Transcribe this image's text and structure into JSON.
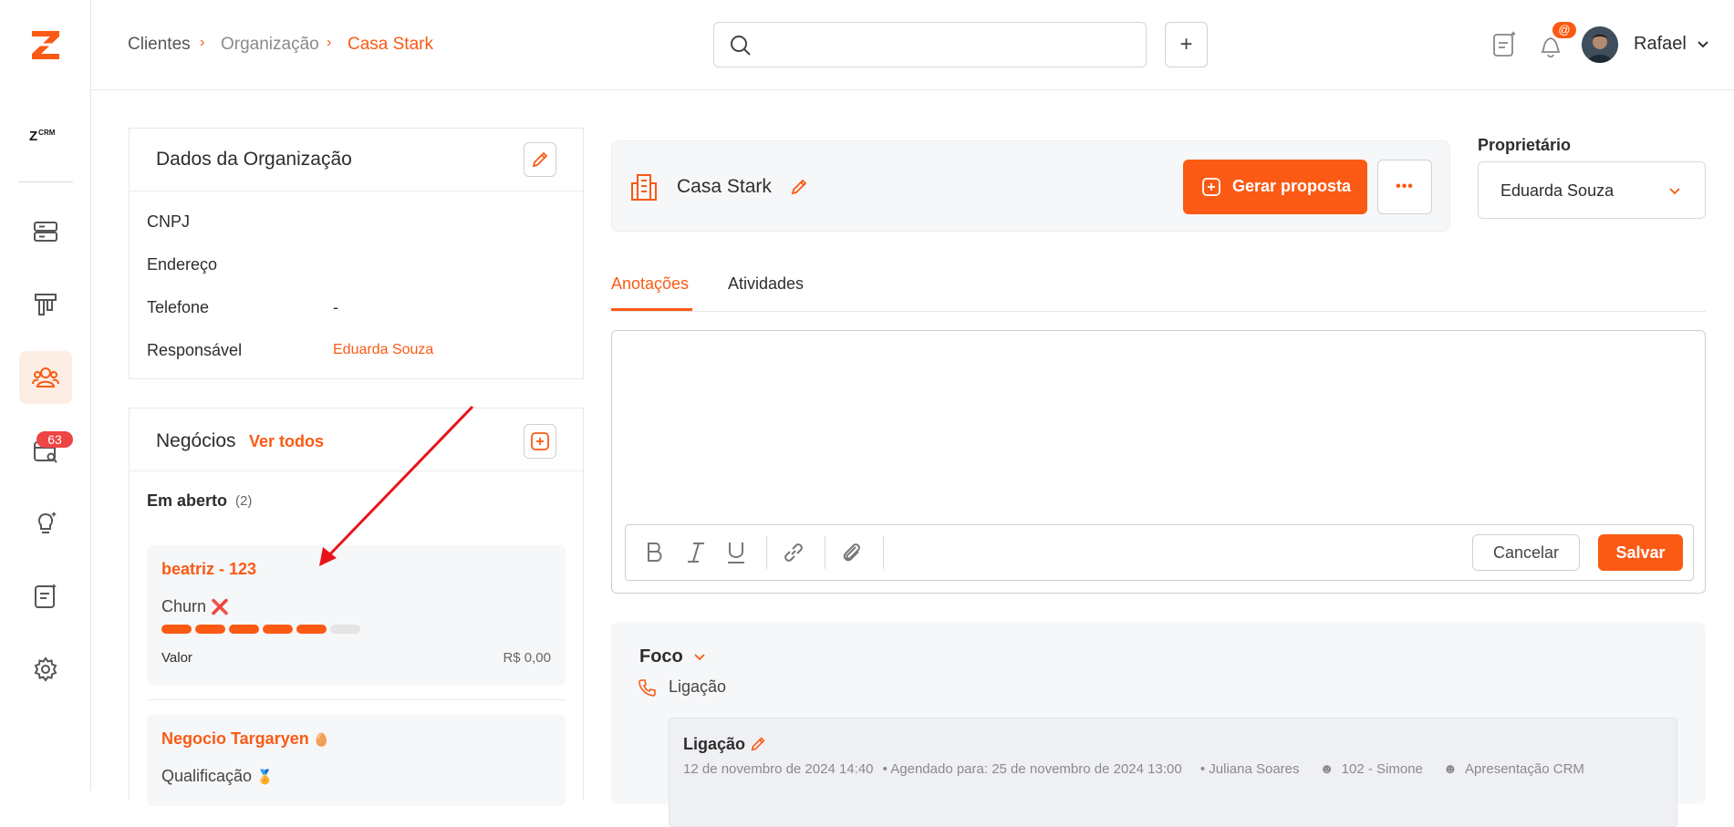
{
  "brand": {
    "logo_letter": "Z",
    "small_logo": "Z",
    "small_logo_suffix": "CRM"
  },
  "sidebar": {
    "items": [
      {
        "icon": "server-icon"
      },
      {
        "icon": "funnel-pillar-icon"
      },
      {
        "icon": "users-icon",
        "active": true
      },
      {
        "icon": "calendar-search-icon",
        "badge": "63"
      },
      {
        "icon": "lightbulb-icon"
      },
      {
        "icon": "note-edit-icon"
      },
      {
        "icon": "gear-icon"
      }
    ]
  },
  "header": {
    "breadcrumb": [
      "Clientes",
      "Organização",
      "Casa Stark"
    ],
    "search_placeholder": "",
    "add_label": "+",
    "notification_badge": "@",
    "user_name": "Rafael"
  },
  "org_panel": {
    "title": "Dados da Organização",
    "fields": [
      {
        "label": "CNPJ",
        "value": ""
      },
      {
        "label": "Endereço",
        "value": ""
      },
      {
        "label": "Telefone",
        "value": "-"
      },
      {
        "label": "Responsável",
        "value": "Eduarda Souza"
      }
    ]
  },
  "deals_panel": {
    "title": "Negócios",
    "see_all": "Ver todos",
    "group_label": "Em aberto",
    "group_count": "(2)",
    "deals": [
      {
        "title": "beatriz - 123",
        "stage": "Churn",
        "stage_emoji": "❌",
        "progress_filled": 5,
        "progress_total": 6,
        "value_label": "Valor",
        "value": "R$ 0,00"
      },
      {
        "title": "Negocio Targaryen",
        "title_emoji": "🥚",
        "stage": "Qualificação",
        "stage_emoji": "🏅"
      }
    ]
  },
  "org_header": {
    "name": "Casa Stark",
    "primary_button": "Gerar proposta",
    "more_button": "•••"
  },
  "owner": {
    "label": "Proprietário",
    "value": "Eduarda Souza"
  },
  "tabs": [
    {
      "label": "Anotações",
      "active": true
    },
    {
      "label": "Atividades",
      "active": false
    }
  ],
  "editor": {
    "placeholder": "",
    "cancel_label": "Cancelar",
    "save_label": "Salvar"
  },
  "focus": {
    "title": "Foco",
    "type_label": "Ligação",
    "activity": {
      "title": "Ligação",
      "created": "12 de novembro de 2024 14:40",
      "scheduled": "• Agendado para: 25 de novembro de 2024 13:00",
      "user": "• Juliana Soares",
      "contact": "102 - Simone",
      "deal": "Apresentação CRM"
    }
  },
  "colors": {
    "accent": "#fa5a14",
    "badge_red": "#ef4444",
    "text": "#2d2d2d",
    "muted": "#8a8a8a"
  }
}
